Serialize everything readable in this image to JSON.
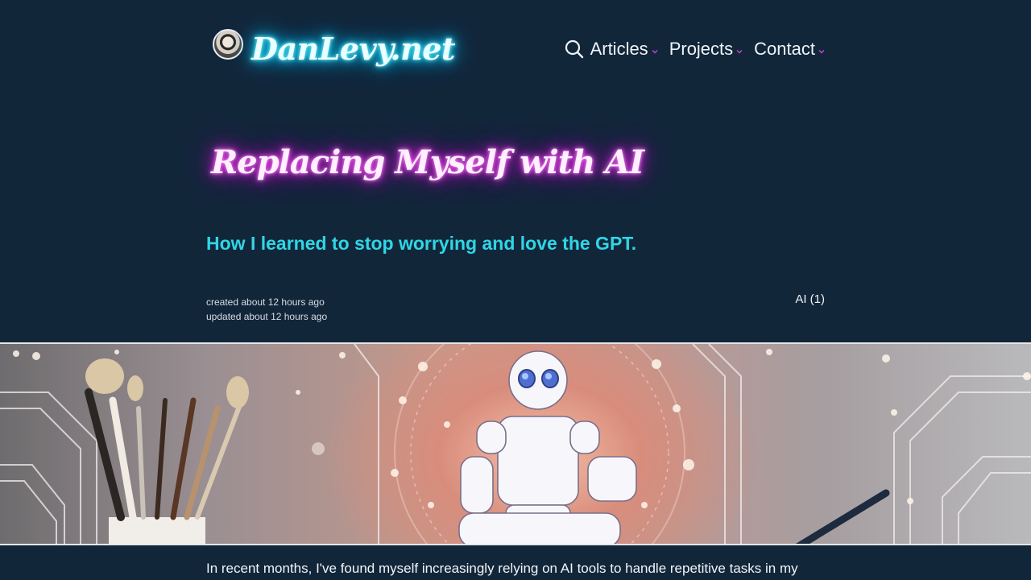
{
  "header": {
    "site_name": "DanLevy.net",
    "nav": [
      {
        "label": "Articles"
      },
      {
        "label": "Projects"
      },
      {
        "label": "Contact"
      }
    ]
  },
  "article": {
    "title": "Replacing Myself with AI",
    "subtitle": "How I learned to stop worrying and love the GPT.",
    "created": "created about 12 hours ago",
    "updated": "updated about 12 hours ago",
    "tag": "AI (1)",
    "intro": "In recent months, I've found myself increasingly relying on AI tools to handle repetitive tasks in my"
  },
  "colors": {
    "background": "#12263a",
    "site_glow": "#22e3ff",
    "title_glow": "#e93de8",
    "subtitle": "#2fd6e6"
  },
  "icons": {
    "search": "search-icon",
    "caret": "chevron-down-icon"
  }
}
